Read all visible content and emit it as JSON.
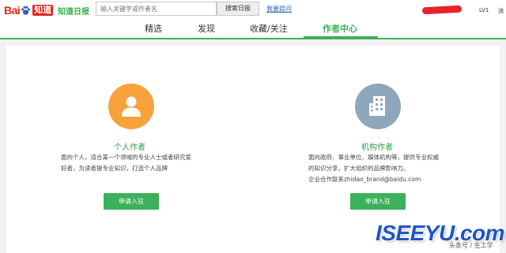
{
  "header": {
    "logo_bai": "Bai",
    "logo_zhidao": "知道",
    "daily_logo": "知道日报",
    "search_placeholder": "输入关键字或作者名",
    "search_button": "搜索日报",
    "ask_link": "我要提问",
    "level": "LV1",
    "message": "消"
  },
  "nav": {
    "tabs": [
      {
        "label": "精选"
      },
      {
        "label": "发现"
      },
      {
        "label": "收藏/关注"
      },
      {
        "label": "作者中心",
        "active": true
      }
    ]
  },
  "cards": {
    "personal": {
      "icon": "person-icon",
      "color": "#f7a23b",
      "title": "个人作者",
      "desc_line1": "面向个人，适合某一个领域的专业人士或者研究爱",
      "desc_line2": "好者，为读者提专业知识，打造个人品牌",
      "button": "申请入驻"
    },
    "organization": {
      "icon": "building-icon",
      "color": "#8ea7ba",
      "title": "机构作者",
      "desc_line1": "面向政府、事业单位、媒体机构等，提供专业权威",
      "desc_line2": "的知识分享，扩大组织的品牌影响力。",
      "desc_line3": "企业合作联系zhidao_brand@baidu.com",
      "button": "申请入驻"
    }
  },
  "watermark": {
    "text": "ISEEYU.com",
    "sub": "头条号 / 生工学"
  },
  "colors": {
    "accent_green": "#3cb05a",
    "brand_red": "#e1251b"
  }
}
